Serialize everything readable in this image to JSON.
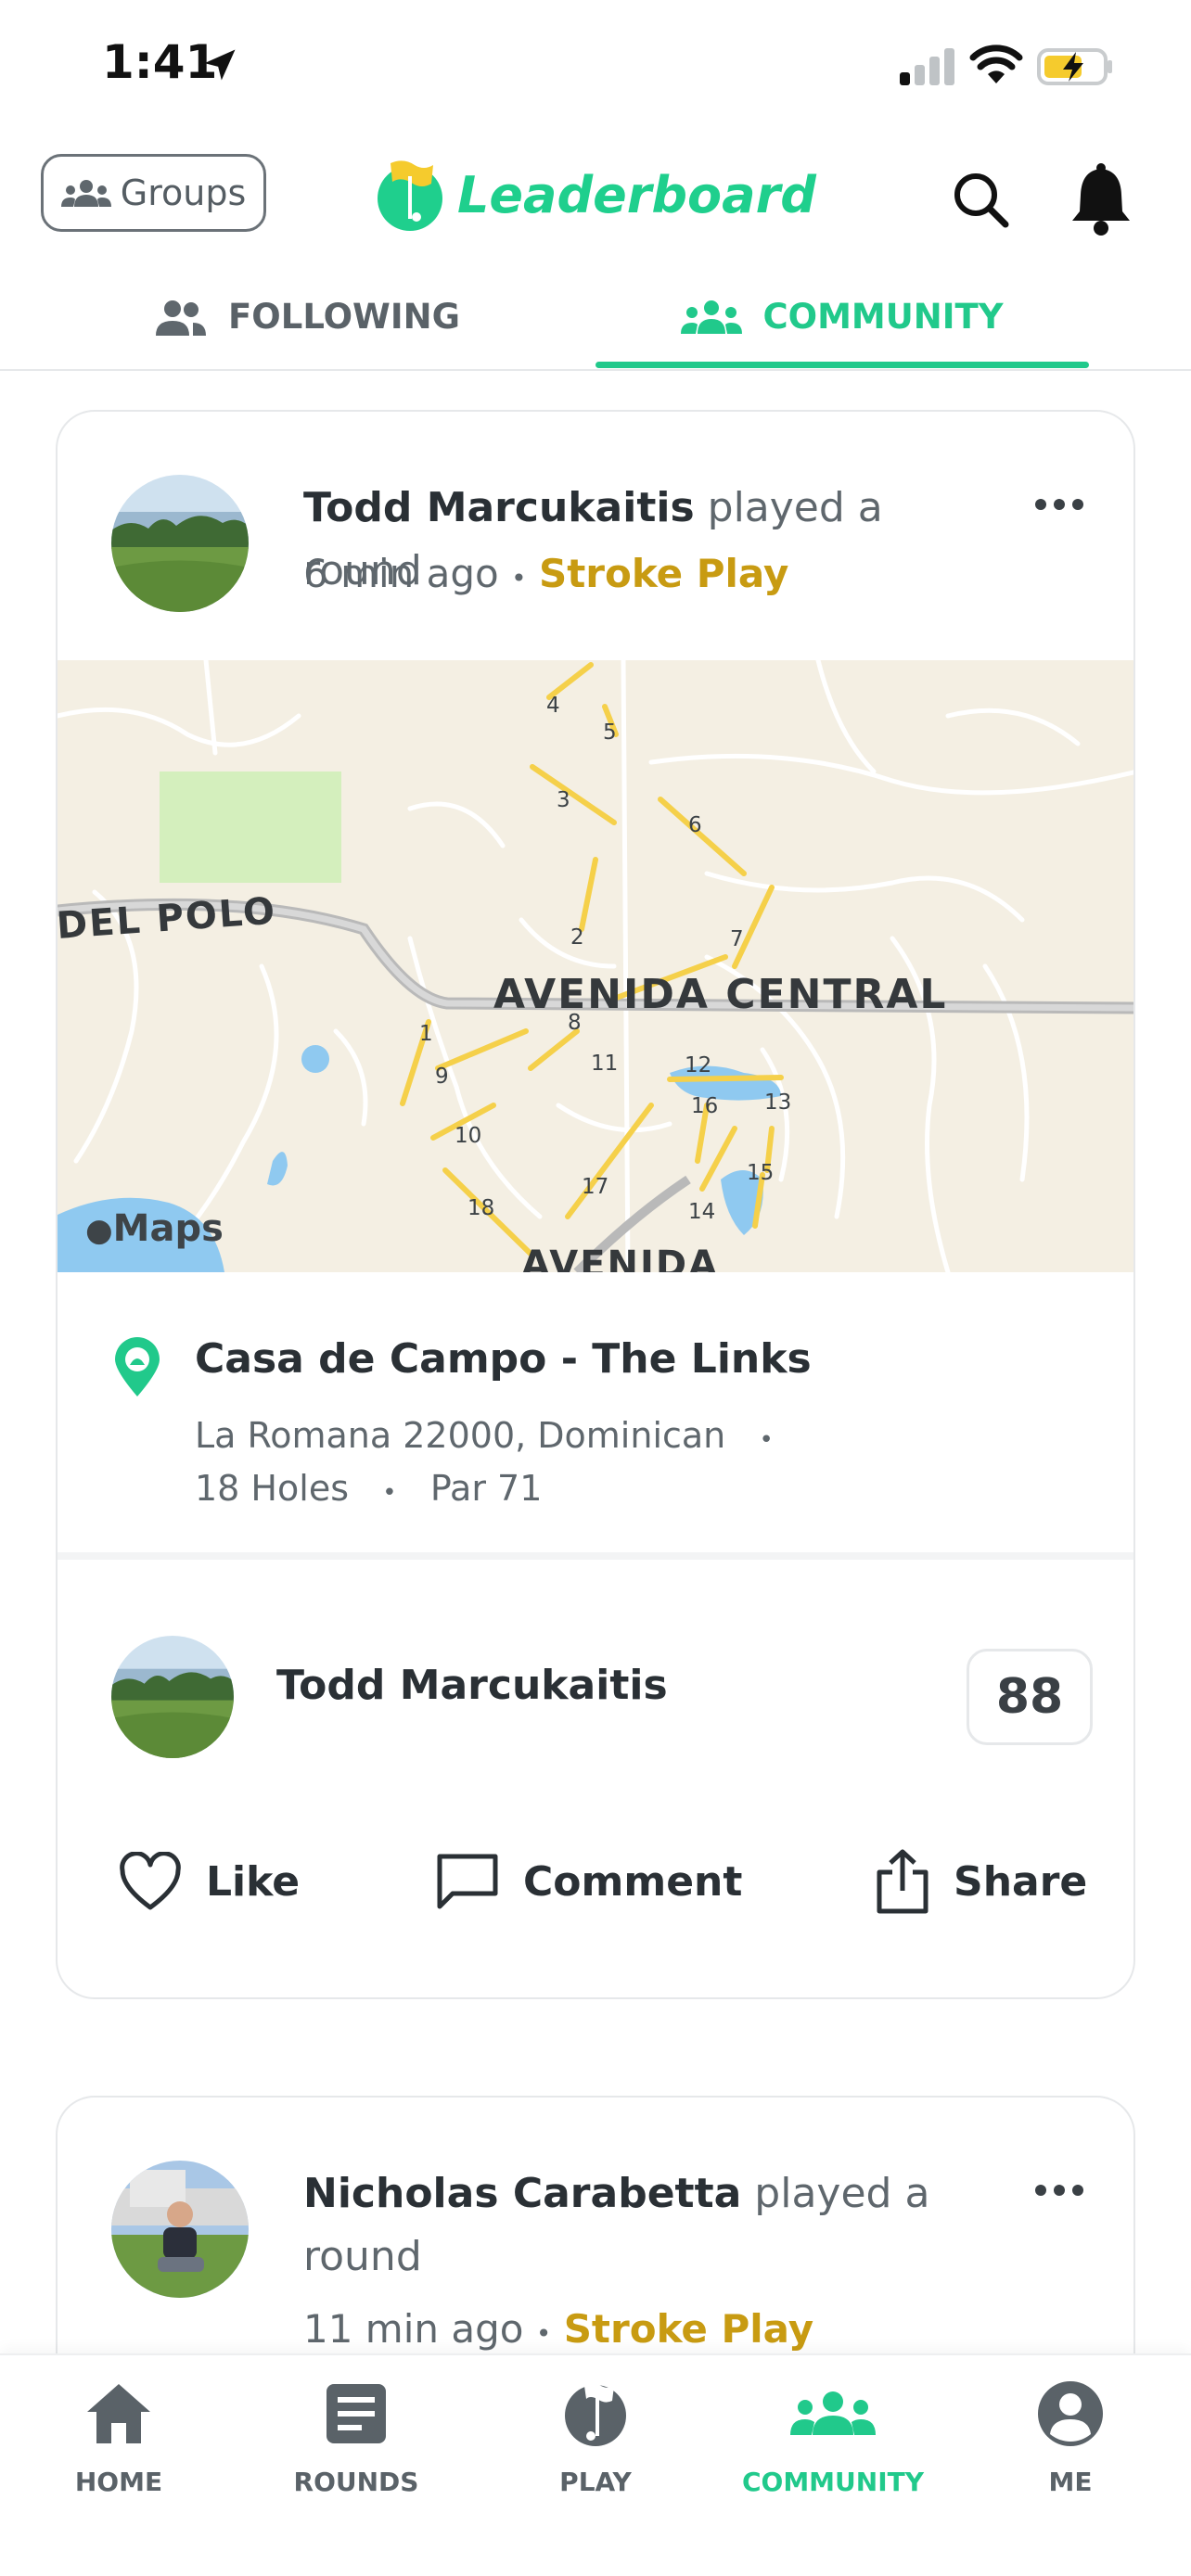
{
  "status_bar": {
    "time": "1:41"
  },
  "header": {
    "groups_label": "Groups",
    "app_title": "Leaderboard"
  },
  "tabs": [
    {
      "label": "FOLLOWING",
      "active": false
    },
    {
      "label": "COMMUNITY",
      "active": true
    }
  ],
  "colors": {
    "accent": "#21c98b",
    "game_type": "#c89b12"
  },
  "feed": [
    {
      "user": "Todd Marcukaitis",
      "action": "played a round",
      "time_ago": "6 min ago",
      "separator": "•",
      "game_type": "Stroke Play",
      "map": {
        "badge": "Maps",
        "streets": [
          "DEL POLO",
          "AVENIDA CENTRAL",
          "AVENIDA"
        ],
        "holes": [
          "1",
          "2",
          "3",
          "4",
          "5",
          "6",
          "7",
          "8",
          "9",
          "10",
          "11",
          "12",
          "13",
          "14",
          "15",
          "16",
          "17",
          "18"
        ]
      },
      "course": {
        "name": "Casa de Campo - The Links",
        "location": "La Romana 22000, Dominican",
        "dot": "•",
        "holes": "18 Holes",
        "par": "Par 71"
      },
      "score": {
        "player": "Todd Marcukaitis",
        "value": "88"
      },
      "actions": {
        "like": "Like",
        "comment": "Comment",
        "share": "Share"
      }
    },
    {
      "user": "Nicholas Carabetta",
      "action": "played a round",
      "time_ago": "11 min ago",
      "separator": "•",
      "game_type": "Stroke Play"
    }
  ],
  "bottom_nav": [
    {
      "label": "HOME",
      "icon": "home-icon",
      "active": false
    },
    {
      "label": "ROUNDS",
      "icon": "scorecard-icon",
      "active": false
    },
    {
      "label": "PLAY",
      "icon": "golf-ball-flag-icon",
      "active": false
    },
    {
      "label": "COMMUNITY",
      "icon": "community-icon",
      "active": true
    },
    {
      "label": "ME",
      "icon": "profile-icon",
      "active": false
    }
  ]
}
